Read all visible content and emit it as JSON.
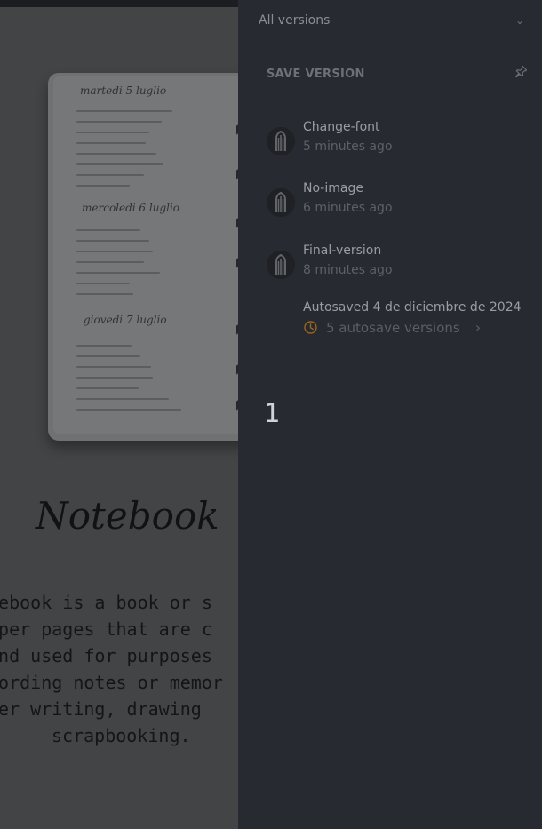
{
  "panel": {
    "filter_value": "All versions",
    "save_version_label": "SAVE VERSION",
    "icons": {
      "chevron": "chevron-down-icon",
      "pin": "pin-icon",
      "clock": "clock-icon",
      "chevron_right": "chevron-right-icon"
    }
  },
  "versions": [
    {
      "name": "Change-font",
      "time": "5 minutes ago"
    },
    {
      "name": "No-image",
      "time": "6 minutes ago"
    },
    {
      "name": "Final-version",
      "time": "8 minutes ago"
    }
  ],
  "autosave": {
    "title": "Autosaved 4 de diciembre de 2024",
    "link": "5 autosave versions"
  },
  "step_number": "1",
  "notebook": {
    "title": "Notebook",
    "lines": [
      "tebook is a book or s",
      "aper pages that are c",
      "and used for purposes",
      "cording notes or memor",
      "her writing, drawing",
      "scrapbooking."
    ],
    "sketch_headings": [
      "martedi 5 luglio",
      "mercoledi 6 luglio",
      "giovedi 7 luglio"
    ]
  }
}
